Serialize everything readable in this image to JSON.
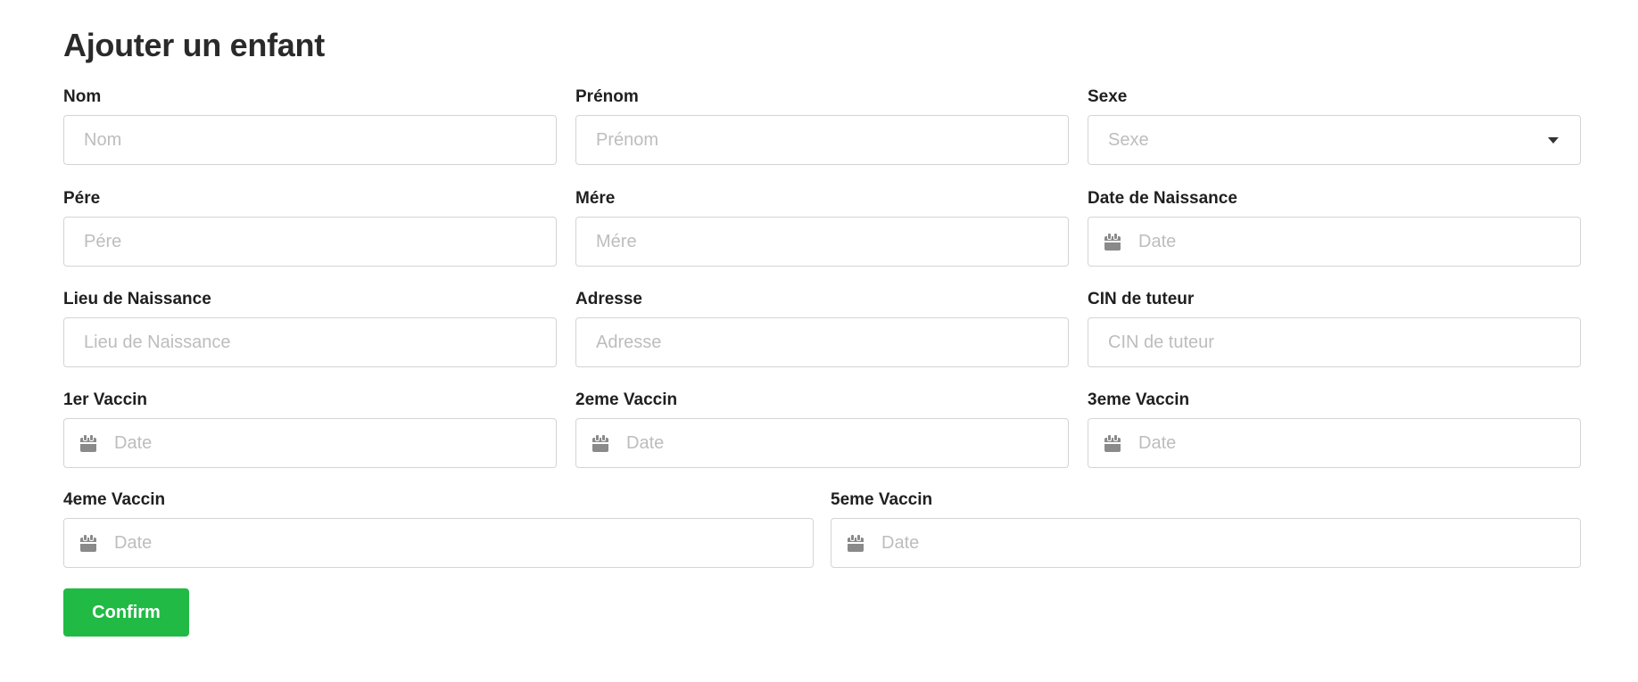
{
  "form": {
    "title": "Ajouter un enfant",
    "fields": {
      "nom": {
        "label": "Nom",
        "placeholder": "Nom"
      },
      "prenom": {
        "label": "Prénom",
        "placeholder": "Prénom"
      },
      "sexe": {
        "label": "Sexe",
        "placeholder": "Sexe"
      },
      "pere": {
        "label": "Pére",
        "placeholder": "Pére"
      },
      "mere": {
        "label": "Mére",
        "placeholder": "Mére"
      },
      "date_naissance": {
        "label": "Date de Naissance",
        "placeholder": "Date"
      },
      "lieu_naissance": {
        "label": "Lieu de Naissance",
        "placeholder": "Lieu de Naissance"
      },
      "adresse": {
        "label": "Adresse",
        "placeholder": "Adresse"
      },
      "cin_tuteur": {
        "label": "CIN de tuteur",
        "placeholder": "CIN de tuteur"
      },
      "vaccin1": {
        "label": "1er Vaccin",
        "placeholder": "Date"
      },
      "vaccin2": {
        "label": "2eme Vaccin",
        "placeholder": "Date"
      },
      "vaccin3": {
        "label": "3eme Vaccin",
        "placeholder": "Date"
      },
      "vaccin4": {
        "label": "4eme Vaccin",
        "placeholder": "Date"
      },
      "vaccin5": {
        "label": "5eme Vaccin",
        "placeholder": "Date"
      }
    },
    "confirm_label": "Confirm"
  },
  "icons": {
    "date_field": "calendar-icon",
    "select": "caret-down-icon"
  },
  "colors": {
    "confirm_button": "#21ba45",
    "placeholder": "#bdbdbd",
    "border": "#d4d4d5",
    "icon": "#8a8a8a"
  }
}
